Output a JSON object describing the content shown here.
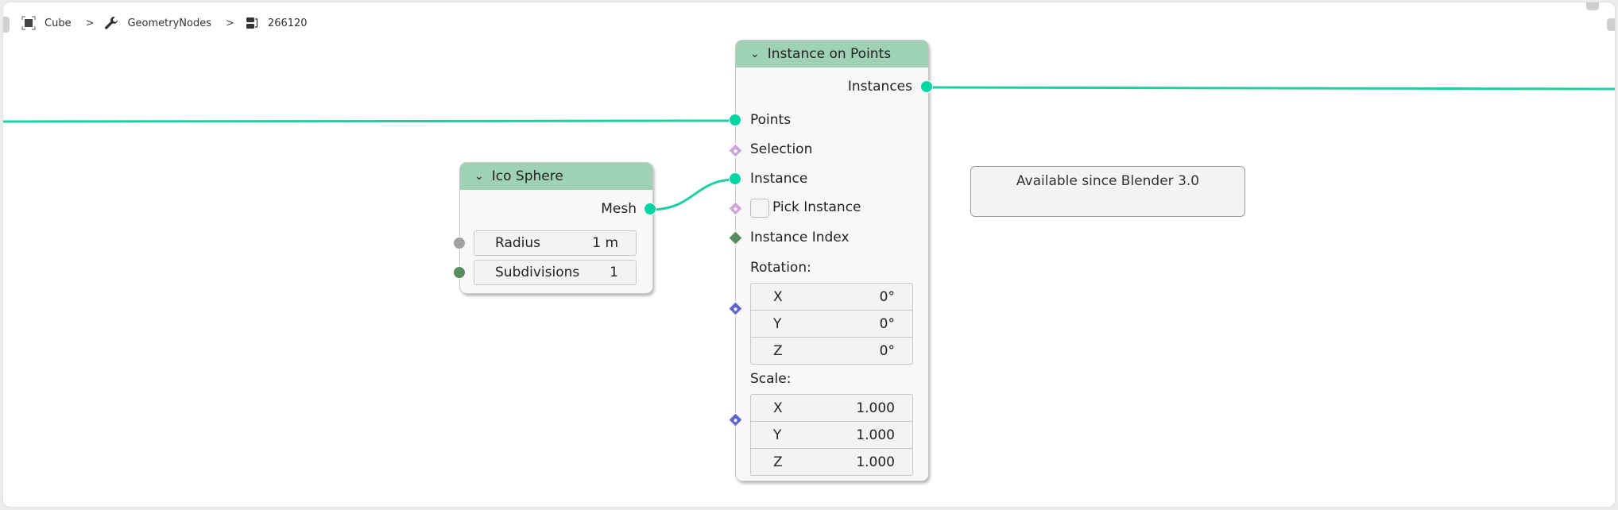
{
  "breadcrumb": {
    "items": [
      {
        "icon": "object-icon",
        "label": "Cube"
      },
      {
        "icon": "wrench-icon",
        "label": "GeometryNodes"
      },
      {
        "icon": "node-tree-icon",
        "label": "266120"
      }
    ],
    "separator": ">"
  },
  "colors": {
    "link": "#1ecfa0",
    "header": "#9fd1b4",
    "geometry_socket": "#00d6a3",
    "boolean_socket": "#cca6d6",
    "integer_socket": "#598c5c",
    "float_socket": "#a1a1a1",
    "vector_socket": "#6363c7"
  },
  "ico_sphere": {
    "title": "Ico Sphere",
    "output": "Mesh",
    "fields": [
      {
        "label": "Radius",
        "value": "1 m"
      },
      {
        "label": "Subdivisions",
        "value": "1"
      }
    ]
  },
  "instance_on_points": {
    "title": "Instance on Points",
    "output": "Instances",
    "inputs": [
      "Points",
      "Selection",
      "Instance"
    ],
    "pick_instance": {
      "label": "Pick Instance",
      "checked": false
    },
    "instance_index": "Instance Index",
    "rotation": {
      "label": "Rotation:",
      "components": [
        {
          "axis": "X",
          "value": "0°"
        },
        {
          "axis": "Y",
          "value": "0°"
        },
        {
          "axis": "Z",
          "value": "0°"
        }
      ]
    },
    "scale": {
      "label": "Scale:",
      "components": [
        {
          "axis": "X",
          "value": "1.000"
        },
        {
          "axis": "Y",
          "value": "1.000"
        },
        {
          "axis": "Z",
          "value": "1.000"
        }
      ]
    }
  },
  "note": {
    "text": "Available since Blender 3.0"
  }
}
